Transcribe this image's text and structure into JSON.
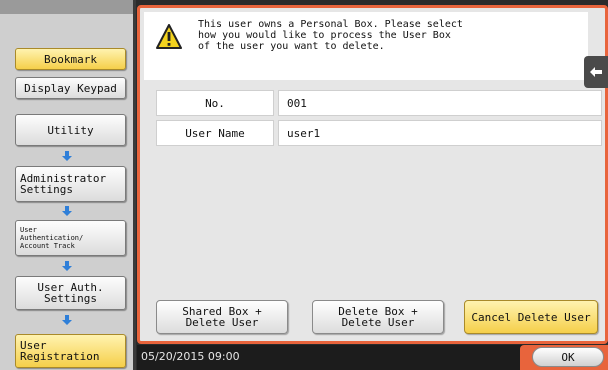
{
  "sidebar": {
    "bookmark": "Bookmark",
    "display_keypad": "Display Keypad",
    "utility": "Utility",
    "administrator_settings": "Administrator\nSettings",
    "user_auth_account_track": "User\nAuthentication/\nAccount Track",
    "user_auth_settings": "User Auth.\nSettings",
    "user_registration": "User\nRegistration"
  },
  "dialog": {
    "message": "This user owns a Personal Box. Please select\nhow you would like to process the User Box\nof the user you want to delete.",
    "fields": [
      {
        "label": "No.",
        "value": "001"
      },
      {
        "label": "User Name",
        "value": "user1"
      }
    ],
    "buttons": {
      "shared_box_delete": "Shared Box +\nDelete User",
      "delete_box_delete": "Delete Box +\nDelete User",
      "cancel_delete": "Cancel Delete User"
    }
  },
  "status": {
    "datetime": "05/20/2015  09:00",
    "ok": "OK"
  },
  "icons": {
    "warning": "warning-icon",
    "back": "back-arrow-icon",
    "down_arrow": "down-arrow-icon"
  },
  "colors": {
    "accent_orange": "#e8643c",
    "highlight_yellow": "#f5cf4a",
    "arrow_blue": "#2f7fd8"
  }
}
